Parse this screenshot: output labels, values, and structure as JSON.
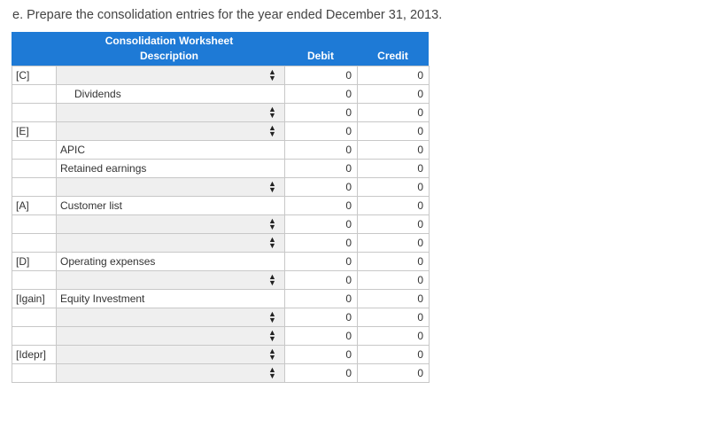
{
  "instruction": "e. Prepare the consolidation entries for the year ended December 31, 2013.",
  "worksheet": {
    "title": "Consolidation Worksheet",
    "description_header": "Description",
    "debit_header": "Debit",
    "credit_header": "Credit",
    "rows": [
      {
        "label": "[C]",
        "desc": "",
        "type": "select",
        "debit": "0",
        "credit": "0"
      },
      {
        "label": "",
        "desc": "Dividends",
        "type": "text-indent",
        "debit": "0",
        "credit": "0"
      },
      {
        "label": "",
        "desc": "",
        "type": "select",
        "debit": "0",
        "credit": "0"
      },
      {
        "label": "[E]",
        "desc": "",
        "type": "select",
        "debit": "0",
        "credit": "0"
      },
      {
        "label": "",
        "desc": "APIC",
        "type": "text",
        "debit": "0",
        "credit": "0"
      },
      {
        "label": "",
        "desc": "Retained earnings",
        "type": "text",
        "debit": "0",
        "credit": "0"
      },
      {
        "label": "",
        "desc": "",
        "type": "select",
        "debit": "0",
        "credit": "0"
      },
      {
        "label": "[A]",
        "desc": "Customer list",
        "type": "text",
        "debit": "0",
        "credit": "0"
      },
      {
        "label": "",
        "desc": "",
        "type": "select",
        "debit": "0",
        "credit": "0"
      },
      {
        "label": "",
        "desc": "",
        "type": "select",
        "debit": "0",
        "credit": "0"
      },
      {
        "label": "[D]",
        "desc": "Operating expenses",
        "type": "text",
        "debit": "0",
        "credit": "0"
      },
      {
        "label": "",
        "desc": "",
        "type": "select",
        "debit": "0",
        "credit": "0"
      },
      {
        "label": "[Igain]",
        "desc": "Equity Investment",
        "type": "text",
        "debit": "0",
        "credit": "0"
      },
      {
        "label": "",
        "desc": "",
        "type": "select",
        "debit": "0",
        "credit": "0"
      },
      {
        "label": "",
        "desc": "",
        "type": "select",
        "debit": "0",
        "credit": "0"
      },
      {
        "label": "[Idepr]",
        "desc": "",
        "type": "select",
        "debit": "0",
        "credit": "0"
      },
      {
        "label": "",
        "desc": "",
        "type": "select",
        "debit": "0",
        "credit": "0"
      }
    ]
  },
  "icons": {
    "select_arrow": "up-down-chevron-icon"
  }
}
